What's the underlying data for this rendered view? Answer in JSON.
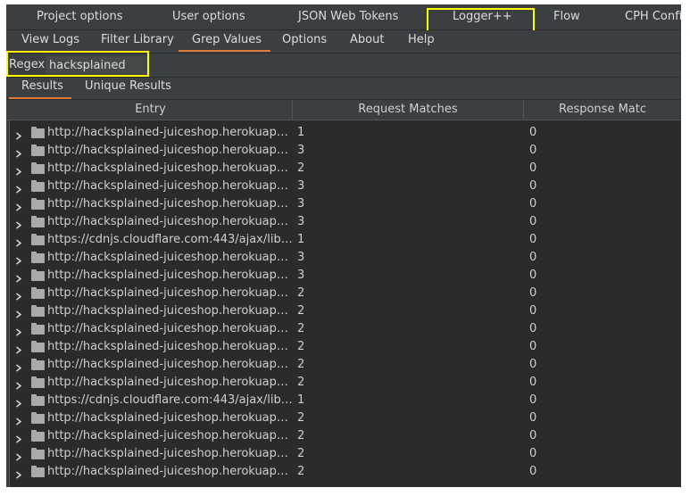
{
  "top_tabs": [
    "Project options",
    "User options",
    "JSON Web Tokens",
    "Logger++",
    "Flow",
    "CPH Confi"
  ],
  "sub_tabs": [
    "View Logs",
    "Filter Library",
    "Grep Values",
    "Options",
    "About",
    "Help"
  ],
  "active_sub_tab": "Grep Values",
  "regex": {
    "label": "Regex:",
    "value": "hacksplained"
  },
  "result_tabs": [
    "Results",
    "Unique Results"
  ],
  "active_result_tab": "Results",
  "table": {
    "columns": [
      "Entry",
      "Request Matches",
      "Response Matc"
    ],
    "rows": [
      {
        "entry": "http://hacksplained-juiceshop.herokuapp.com:...",
        "req": "1",
        "resp": "0"
      },
      {
        "entry": "http://hacksplained-juiceshop.herokuapp.com:...",
        "req": "3",
        "resp": "0"
      },
      {
        "entry": "http://hacksplained-juiceshop.herokuapp.com:...",
        "req": "2",
        "resp": "0"
      },
      {
        "entry": "http://hacksplained-juiceshop.herokuapp.com:...",
        "req": "3",
        "resp": "0"
      },
      {
        "entry": "http://hacksplained-juiceshop.herokuapp.com:...",
        "req": "3",
        "resp": "0"
      },
      {
        "entry": "http://hacksplained-juiceshop.herokuapp.com:...",
        "req": "3",
        "resp": "0"
      },
      {
        "entry": "https://cdnjs.cloudflare.com:443/ajax/libs/coo...",
        "req": "1",
        "resp": "0"
      },
      {
        "entry": "http://hacksplained-juiceshop.herokuapp.com:...",
        "req": "3",
        "resp": "0"
      },
      {
        "entry": "http://hacksplained-juiceshop.herokuapp.com:...",
        "req": "3",
        "resp": "0"
      },
      {
        "entry": "http://hacksplained-juiceshop.herokuapp.com:...",
        "req": "2",
        "resp": "0"
      },
      {
        "entry": "http://hacksplained-juiceshop.herokuapp.com:...",
        "req": "2",
        "resp": "0"
      },
      {
        "entry": "http://hacksplained-juiceshop.herokuapp.com:...",
        "req": "2",
        "resp": "0"
      },
      {
        "entry": "http://hacksplained-juiceshop.herokuapp.com:...",
        "req": "2",
        "resp": "0"
      },
      {
        "entry": "http://hacksplained-juiceshop.herokuapp.com:...",
        "req": "2",
        "resp": "0"
      },
      {
        "entry": "http://hacksplained-juiceshop.herokuapp.com:...",
        "req": "2",
        "resp": "0"
      },
      {
        "entry": "https://cdnjs.cloudflare.com:443/ajax/libs/coo...",
        "req": "1",
        "resp": "0"
      },
      {
        "entry": "http://hacksplained-juiceshop.herokuapp.com:...",
        "req": "2",
        "resp": "0"
      },
      {
        "entry": "http://hacksplained-juiceshop.herokuapp.com:...",
        "req": "2",
        "resp": "0"
      },
      {
        "entry": "http://hacksplained-juiceshop.herokuapp.com:...",
        "req": "2",
        "resp": "0"
      },
      {
        "entry": "http://hacksplained-juiceshop.herokuapp.com:...",
        "req": "2",
        "resp": "0"
      }
    ]
  },
  "colors": {
    "background": "#3c3f41",
    "table_bg": "#2b2b2b",
    "highlight": "#ffff00",
    "accent": "#e07a3a"
  },
  "icons": {
    "expand": "chevron-right-icon",
    "entry": "folder-icon"
  }
}
